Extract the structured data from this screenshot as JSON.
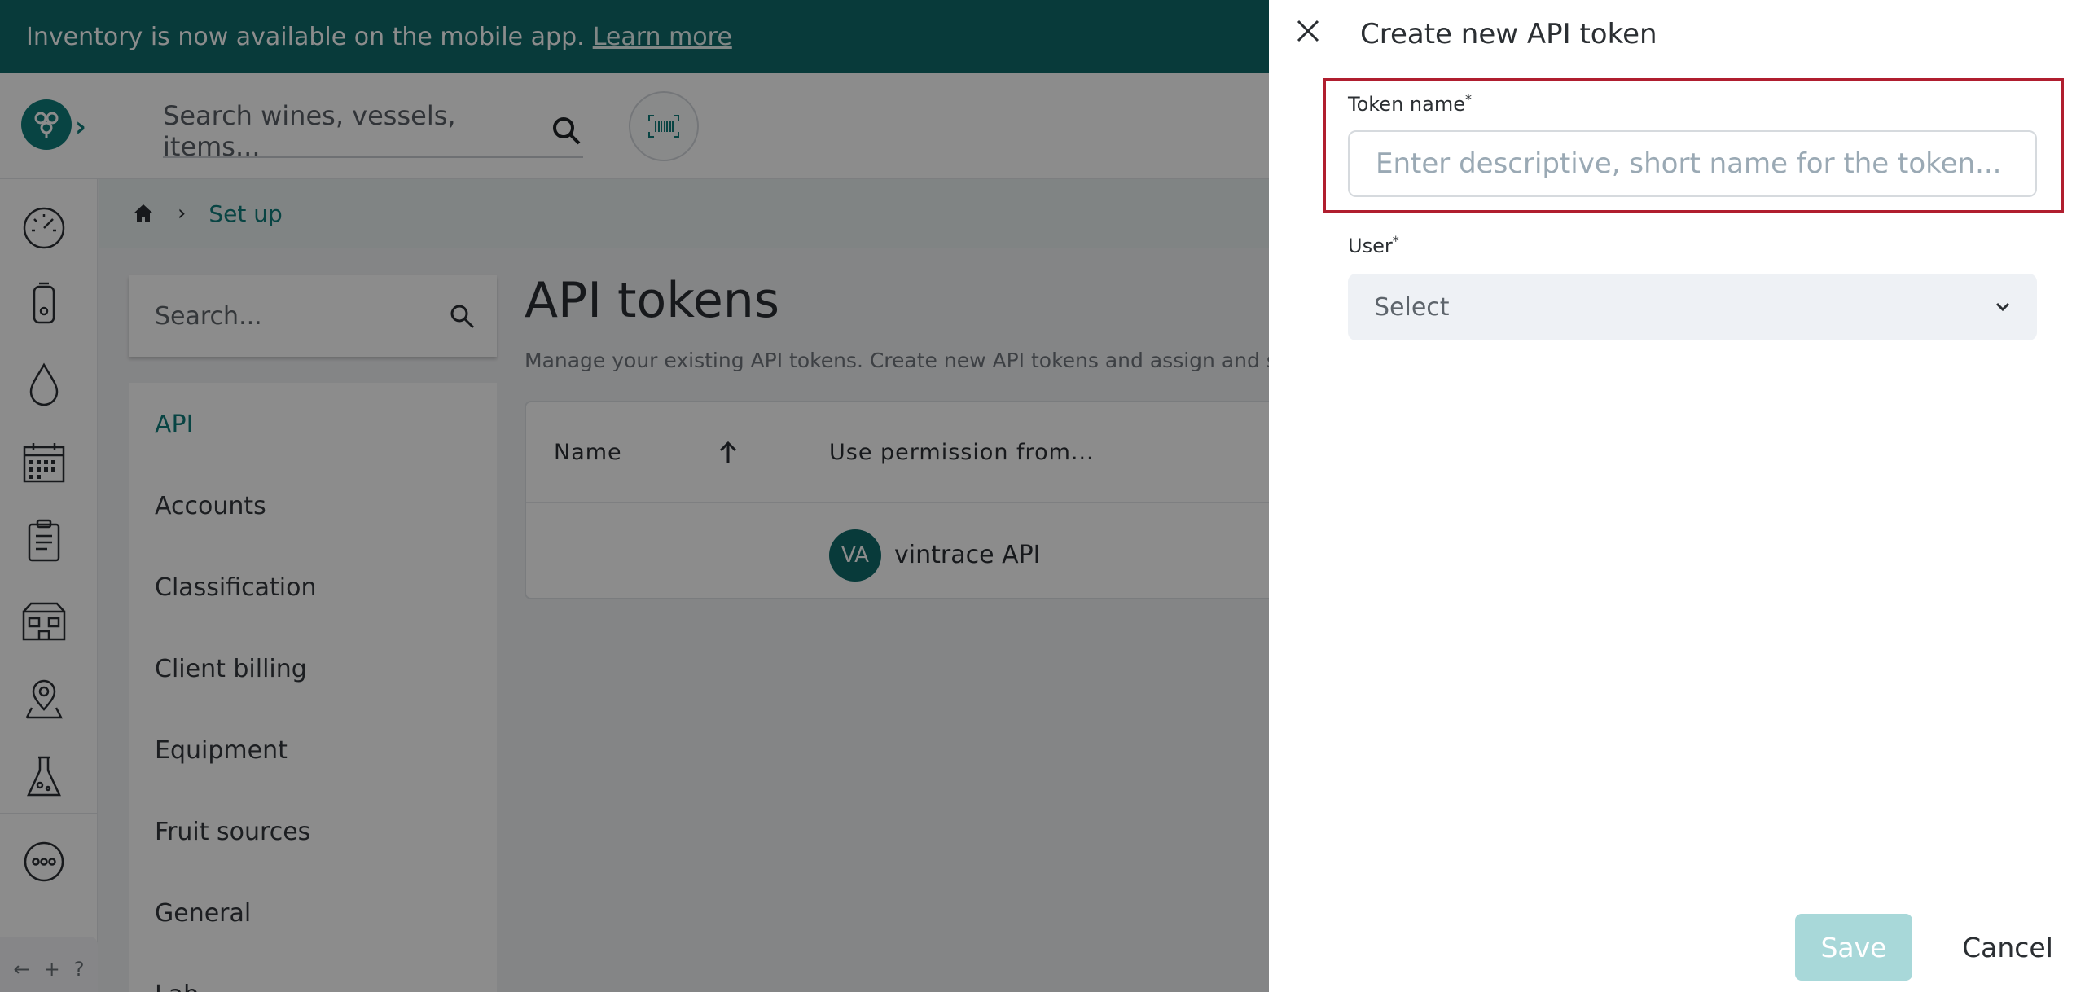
{
  "banner": {
    "text": "Inventory is now available on the mobile app.",
    "link": "Learn more"
  },
  "header": {
    "search_placeholder": "Search wines, vessels, items..."
  },
  "rail": {
    "icons": [
      "dashboard-icon",
      "vessel-icon",
      "drop-icon",
      "calendar-icon",
      "clipboard-icon",
      "winery-icon",
      "location-icon",
      "lab-flask-icon",
      "more-icon"
    ],
    "footer": [
      "←",
      "+",
      "?"
    ]
  },
  "breadcrumb": {
    "current": "Set up"
  },
  "sidebar": {
    "search_placeholder": "Search...",
    "items": [
      {
        "label": "API",
        "active": true
      },
      {
        "label": "Accounts"
      },
      {
        "label": "Classification"
      },
      {
        "label": "Client billing"
      },
      {
        "label": "Equipment"
      },
      {
        "label": "Fruit sources"
      },
      {
        "label": "General"
      },
      {
        "label": "Lab"
      }
    ]
  },
  "main": {
    "title": "API tokens",
    "description": "Manage your existing API tokens. Create new API tokens and assign and sha",
    "table": {
      "columns": [
        "Name",
        "Use permission from..."
      ],
      "rows": [
        {
          "avatar": "VA",
          "permission_from": "vintrace API"
        }
      ]
    }
  },
  "drawer": {
    "title": "Create new API token",
    "token_label": "Token name",
    "token_placeholder": "Enter descriptive, short name for the token...",
    "user_label": "User",
    "user_select": "Select",
    "required_mark": "*",
    "save": "Save",
    "cancel": "Cancel"
  },
  "colors": {
    "brand": "#0f6b6b",
    "accent": "#0f7c7a",
    "highlight": "#b01e2f",
    "save_disabled": "#a8d8d9"
  }
}
